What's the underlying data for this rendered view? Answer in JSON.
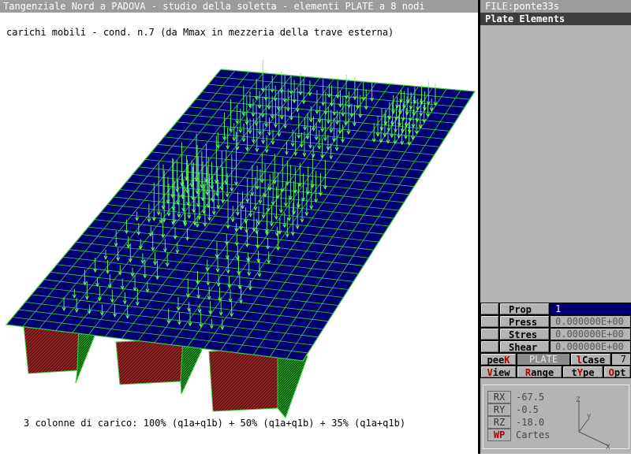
{
  "window": {
    "title": "Tangenziale Nord a PADOVA - studio della soletta - elementi PLATE a 8 nodi",
    "file": "FILE:ponte33s"
  },
  "panel": {
    "header": "Plate Elements"
  },
  "canvas": {
    "subtitle": "carichi mobili - cond. n.7 (da Mmax in mezzeria della trave esterna)",
    "caption": "3 colonne di carico: 100% (q1a+q1b) + 50% (q1a+q1b) + 35% (q1a+q1b)"
  },
  "properties": {
    "prop": {
      "label": "Prop",
      "value": "1"
    },
    "press": {
      "label": "Press",
      "value": "0.000000E+00"
    },
    "stres": {
      "label": "Stres",
      "value": "0.000000E+00"
    },
    "shear": {
      "label": "Shear",
      "value": "0.000000E+00"
    }
  },
  "toolbar1": {
    "peek": {
      "pre": "pee",
      "hot": "K"
    },
    "plate": "PLATE",
    "lcase": {
      "hot": "l",
      "rest": "Case"
    },
    "lcase_value": "7"
  },
  "toolbar2": {
    "view": {
      "hot": "V",
      "rest": "iew"
    },
    "range": {
      "hot": "R",
      "rest": "ange"
    },
    "type": {
      "pre": "t",
      "hot": "Y",
      "rest": "pe"
    },
    "opt": {
      "hot": "O",
      "rest": "pt"
    }
  },
  "rotation": {
    "rx": {
      "label": "RX",
      "value": "-67.5"
    },
    "ry": {
      "label": "RY",
      "value": "-0.5"
    },
    "rz": {
      "label": "RZ",
      "value": "-18.0"
    },
    "wp": {
      "label": "WP",
      "value": "Cartes"
    }
  },
  "axes": {
    "x": "X",
    "y": "Y",
    "z": "Z"
  },
  "colors": {
    "deck": "#000070",
    "mesh": "#3ccc3c",
    "load": "#60ff60",
    "beam_side": "#701010",
    "beam_end": "#0a6a0a"
  }
}
